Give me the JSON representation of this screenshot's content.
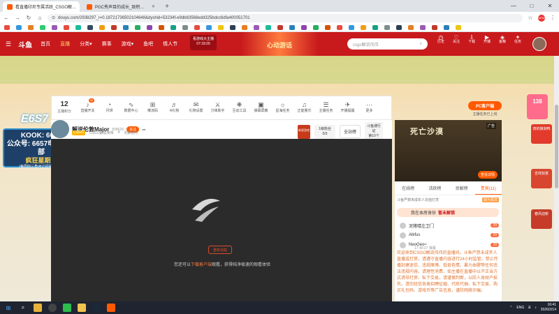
{
  "browser": {
    "tabs": [
      {
        "title": "看直播印尼专属活跃_CSGO解…",
        "active": true
      },
      {
        "title": "PGC秀声目的成长_致积…",
        "active": false
      }
    ],
    "url": "douyu.com/2938297_r=0.18721736502104648&dyshid=53234f-e9db83568edd325bdcc6dfa400051701",
    "new_tab": "+",
    "win_min": "—",
    "win_max": "□",
    "win_close": "✕",
    "back": "←",
    "forward": "→",
    "reload": "↻",
    "home": "⌂",
    "star": "☆",
    "menu": "⋮"
  },
  "site": {
    "logo": "斗鱼",
    "nav": [
      "首页",
      "直播",
      "分类▾",
      "赛事",
      "游戏▾",
      "鱼吧",
      "情人节"
    ],
    "active_nav": "直播",
    "promo": {
      "line1": "看游戏大主播",
      "line2": "07:18:26"
    },
    "banner": "心动游话",
    "search_placeholder": "csgo解说伟伟",
    "search_icon": "search-icon",
    "user_icons": [
      {
        "icon": "history-icon",
        "label": "历史"
      },
      {
        "icon": "follow-icon",
        "label": "关注"
      },
      {
        "icon": "download-icon",
        "label": "下载"
      },
      {
        "icon": "broadcast-icon",
        "label": "开播"
      },
      {
        "icon": "wallet-icon",
        "label": "鱼粮"
      },
      {
        "icon": "task-icon",
        "label": "任务"
      }
    ]
  },
  "toolbar": {
    "rank_value": "12",
    "rank_label": "主播积分",
    "items": [
      {
        "label": "直播开关",
        "icon": "♪",
        "badge": "38"
      },
      {
        "label": "月饼",
        "icon": "◔"
      },
      {
        "label": "数据中心",
        "icon": "∿"
      },
      {
        "label": "推流码",
        "icon": "⊞"
      },
      {
        "label": "A礼物",
        "icon": "♬"
      },
      {
        "label": "礼物设置",
        "icon": "✉"
      },
      {
        "label": "刀锋助手",
        "icon": "⚔"
      },
      {
        "label": "互动工具",
        "icon": "❋"
      },
      {
        "label": "弹幕屏蔽",
        "icon": "▣"
      },
      {
        "label": "星海任务",
        "icon": "☼"
      },
      {
        "label": "正能量乐",
        "icon": "♫"
      },
      {
        "label": "主播任务",
        "icon": "☰"
      },
      {
        "label": "开播提醒",
        "icon": "✈"
      },
      {
        "label": "更多",
        "icon": "⋯"
      }
    ],
    "pc_button": "PC客户端",
    "pc_sub": "主播任务已上线"
  },
  "room": {
    "name": "解说伦敦Major",
    "room_id": "838626",
    "follow": "关注",
    "category_tag": "CSGO",
    "category": "CSGO解说伟伟",
    "stat": "4",
    "report": "无聊暂时",
    "gift_label": "新晋游戏",
    "fans_label": "1级粉丝",
    "fans_value": "0/3",
    "all_btn": "全站榜",
    "doushi": "斗鱼通行证",
    "doushi_sub": "第10个"
  },
  "player": {
    "retry": "重新加载",
    "message_a": "您还可以",
    "message_link": "下载客户端",
    "message_b": "观看，获得纯净极速的观看体验"
  },
  "overlay": {
    "logo": "E6S7",
    "line1": "KOOK: 6657",
    "line2": "公众号: 6657电竞俱乐部",
    "line3": "疯狂星期四",
    "line4": "(每周四三角洲订阅抽奖活动)"
  },
  "sidebar": {
    "ad_title": "死亡沙漠",
    "ad_tag": "广告",
    "ad_button": "查看详情",
    "tabs": [
      "在线榜",
      "活跃榜",
      "贡献榜",
      "贵宾(11)"
    ],
    "active_tab": "贵宾(11)",
    "notice_text": "斗鱼严禁未成年人充值打赏",
    "notice_btn": "成为贵宾",
    "contrib_label": "我在本房身份",
    "contrib_value": "暂未解锁",
    "contributors": [
      {
        "name": "泥猪嘻左卫门",
        "level": "29"
      },
      {
        "name": "Alkfus",
        "level": "29"
      },
      {
        "name": "NeoGeo≈",
        "level": "29"
      }
    ],
    "chat_label": "17:40:27 弹幕",
    "chat_text": "欢迎来到CSGO解说伟伟的直播间。斗鱼严禁未成年人直播或打赏，请遵守直播内容进行24小时监管。禁止传播封建迷信、违规赌博、低俗色情、暴力血腥等任何违法违规内容。请理性消费，如主播在直播中以不正当方式诱导打赏、私下交易，请谨慎判断，以防人身财产损失。请勿轻信各类招聘征婚、代练代抽、私下交易、购买礼包码、游戏币等广告信息，谨防网络诈骗。"
  },
  "right_panel": {
    "badge": "138",
    "ads": [
      "真的狼剑鸭",
      "吉祥如意",
      "春风迎新"
    ]
  },
  "taskbar": {
    "icons": [
      "windows-icon",
      "search-icon",
      "chrome-icon",
      "obs-icon",
      "wechat-icon",
      "files-icon",
      "steam-icon",
      "douyu-icon"
    ],
    "lang": "ENG",
    "time": "16:41",
    "date": "2026/2/14"
  }
}
